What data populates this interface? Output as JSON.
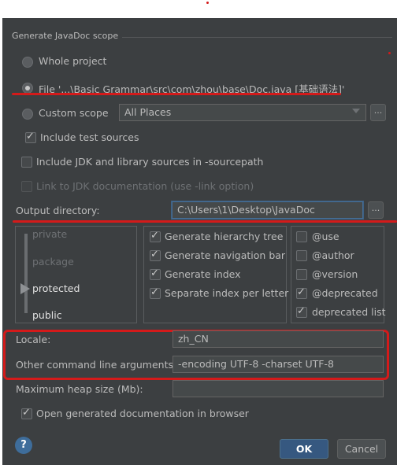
{
  "dialog": {
    "scope_group_label": "Generate JavaDoc scope",
    "scope_options": {
      "whole_project": "Whole project",
      "file": "File '...\\Basic Grammar\\src\\com\\zhou\\base\\Doc.java [基础语法]'",
      "custom_scope": "Custom scope",
      "custom_scope_value": "All Places"
    },
    "include_test_sources": "Include test sources",
    "include_jdk_sources": "Include JDK and library sources in -sourcepath",
    "link_to_jdk": "Link to JDK documentation (use -link option)",
    "output_directory_label": "Output directory:",
    "output_directory_value": "C:\\Users\\1\\Desktop\\JavaDoc",
    "browse_label": "...",
    "visibility_levels": [
      "private",
      "package",
      "protected",
      "public"
    ],
    "selected_visibility": "protected",
    "generate_options": [
      {
        "label": "Generate hierarchy tree",
        "checked": true
      },
      {
        "label": "Generate navigation bar",
        "checked": true
      },
      {
        "label": "Generate index",
        "checked": true
      },
      {
        "label": "Separate index per letter",
        "checked": true
      }
    ],
    "tag_options": [
      {
        "label": "@use",
        "checked": false
      },
      {
        "label": "@author",
        "checked": false
      },
      {
        "label": "@version",
        "checked": false
      },
      {
        "label": "@deprecated",
        "checked": true
      },
      {
        "label": "deprecated list",
        "checked": true
      }
    ],
    "locale_label": "Locale:",
    "locale_value": "zh_CN",
    "other_args_label": "Other command line arguments:",
    "other_args_value": "-encoding UTF-8 -charset UTF-8",
    "max_heap_label": "Maximum heap size (Mb):",
    "max_heap_value": "",
    "open_in_browser": "Open generated documentation in browser",
    "help_symbol": "?",
    "ok_label": "OK",
    "cancel_label": "Cancel"
  },
  "colors": {
    "background": "#3c3f41",
    "accent": "#365880",
    "annotation": "#d41a1a"
  }
}
